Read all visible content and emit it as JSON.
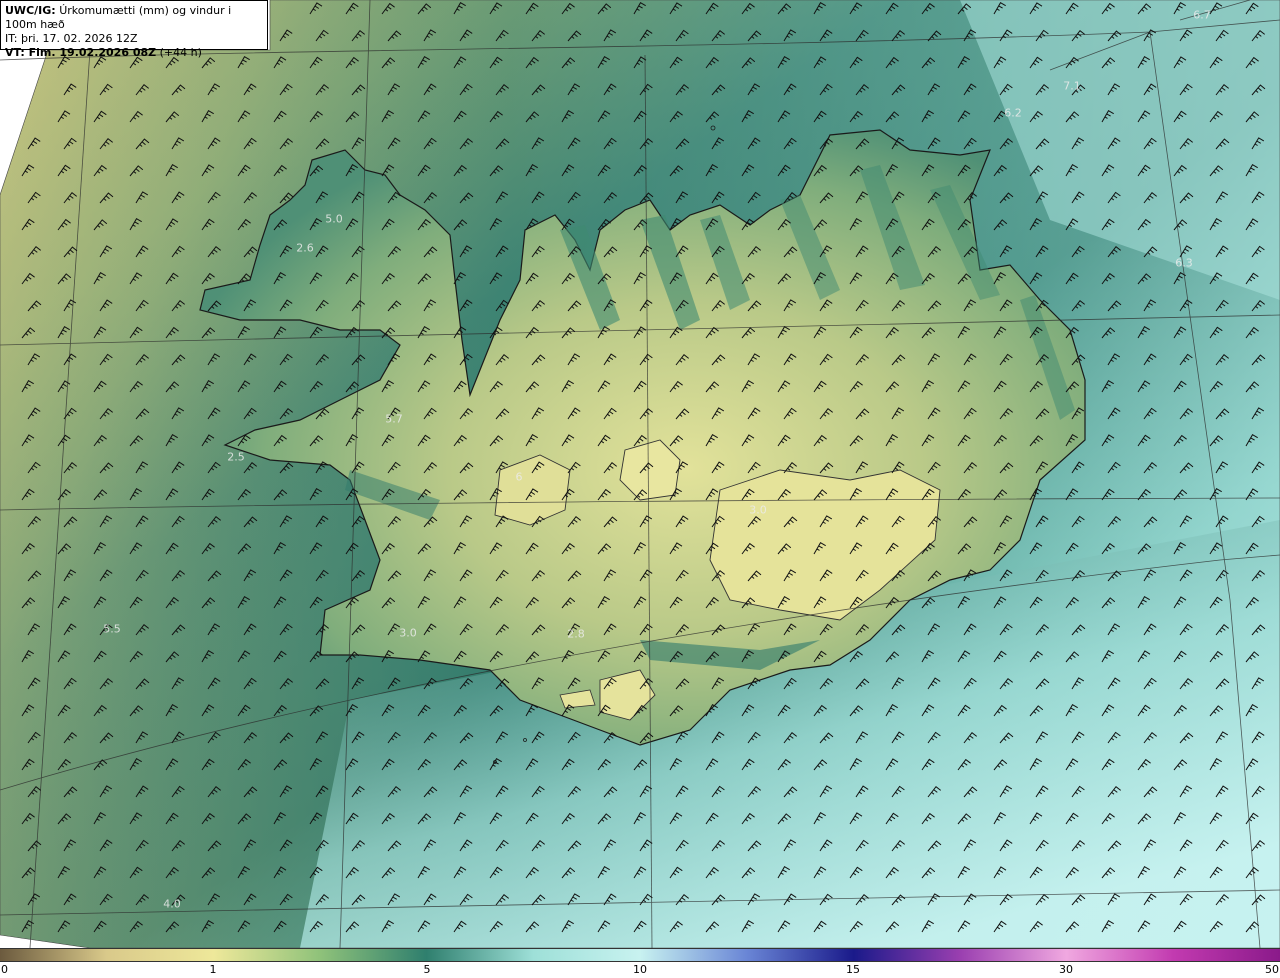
{
  "header": {
    "title_prefix": "UWC/IG:",
    "title_text": "Úrkomumætti (mm) og vindur i 100m hæð",
    "initial_time": "IT: þri. 17. 02. 2026 12Z",
    "valid_time_prefix": "VT: Fim. 19.02.2026 08Z",
    "valid_time_suffix": "(+44 h)"
  },
  "colorbar": {
    "ticks": [
      "0",
      "1",
      "5",
      "10",
      "15",
      "30",
      "50"
    ],
    "colors": [
      "#6b5a3e",
      "#d9c98a",
      "#eee89a",
      "#8fc27a",
      "#2f7f6e",
      "#9ee0d8",
      "#c8f2f0",
      "#6a86d6",
      "#1a1a8a",
      "#9a3fb0",
      "#f0a8e0",
      "#c23ab0",
      "#8a1a8a"
    ]
  },
  "station_values": [
    {
      "id": "nw-fjords",
      "text": "5.0"
    },
    {
      "id": "nw-inland",
      "text": "2.6"
    },
    {
      "id": "breidafj",
      "text": "5.7"
    },
    {
      "id": "snaefell",
      "text": "2.5"
    },
    {
      "id": "hofsjokull",
      "text": "6"
    },
    {
      "id": "vatnajokull",
      "text": "3.0"
    },
    {
      "id": "sw-sea",
      "text": "5.5"
    },
    {
      "id": "reykjanes",
      "text": "3.0"
    },
    {
      "id": "south",
      "text": "2.8"
    },
    {
      "id": "ne-sea-1",
      "text": "7.1"
    },
    {
      "id": "ne-sea-2",
      "text": "6.2"
    },
    {
      "id": "east-sea",
      "text": "6.3"
    },
    {
      "id": "far-ne",
      "text": "6.7"
    },
    {
      "id": "south-sea",
      "text": "4.0"
    }
  ],
  "colors": {
    "land_outline": "#1a1a1a",
    "grid_lines": "#2b2b2b",
    "barb_color": "#111111"
  }
}
